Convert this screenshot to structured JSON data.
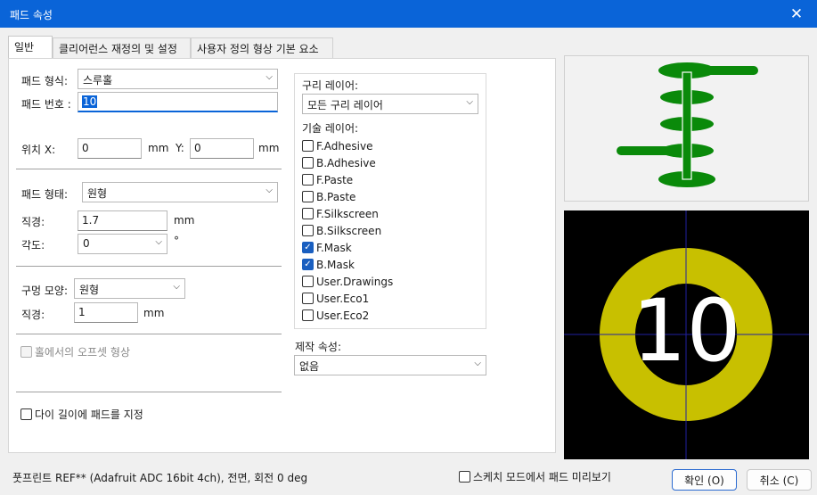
{
  "window": {
    "title": "패드 속성",
    "close_glyph": "✕"
  },
  "tabs": [
    "일반",
    "클리어런스 재정의 및 설정",
    "사용자 정의 형상 기본 요소"
  ],
  "general": {
    "pad_type_label": "패드 형식:",
    "pad_type_value": "스루홀",
    "pad_number_label": "패드 번호 :",
    "pad_number_value": "10",
    "position_x_label": "위치 X:",
    "position_x_value": "0",
    "position_x_unit": "mm",
    "position_y_label": "Y:",
    "position_y_value": "0",
    "position_y_unit": "mm",
    "pad_shape_label": "패드 형태:",
    "pad_shape_value": "원형",
    "diameter_label": "직경:",
    "diameter_value": "1.7",
    "diameter_unit": "mm",
    "angle_label": "각도:",
    "angle_value": "0",
    "angle_unit": "°",
    "hole_shape_label": "구멍 모양:",
    "hole_shape_value": "원형",
    "hole_diameter_label": "직경:",
    "hole_diameter_value": "1",
    "hole_diameter_unit": "mm",
    "offset_label": "홀에서의 오프셋 형상",
    "offset_checked": false,
    "die_length_label": "다이 길이에 패드를 지정",
    "die_length_checked": false
  },
  "layers": {
    "copper_label": "구리 레이어:",
    "copper_value": "모든 구리 레이어",
    "tech_label": "기술 레이어:",
    "items": [
      {
        "label": "F.Adhesive",
        "checked": false
      },
      {
        "label": "B.Adhesive",
        "checked": false
      },
      {
        "label": "F.Paste",
        "checked": false
      },
      {
        "label": "B.Paste",
        "checked": false
      },
      {
        "label": "F.Silkscreen",
        "checked": false
      },
      {
        "label": "B.Silkscreen",
        "checked": false
      },
      {
        "label": "F.Mask",
        "checked": true
      },
      {
        "label": "B.Mask",
        "checked": true
      },
      {
        "label": "User.Drawings",
        "checked": false
      },
      {
        "label": "User.Eco1",
        "checked": false
      },
      {
        "label": "User.Eco2",
        "checked": false
      }
    ],
    "fab_label": "제작 속성:",
    "fab_value": "없음"
  },
  "preview": {
    "pad_number": "10",
    "pad_color": "#c8c000",
    "crosshair_color": "#2020a0",
    "background": "#000000",
    "stack_color": "#0a8a0a"
  },
  "footer": {
    "footprint_info": "풋프린트 REF** (Adafruit ADC 16bit 4ch), 전면, 회전 0 deg",
    "sketch_label": "스케치 모드에서 패드 미리보기",
    "ok_label": "확인 (O)",
    "cancel_label": "취소 (C)"
  }
}
